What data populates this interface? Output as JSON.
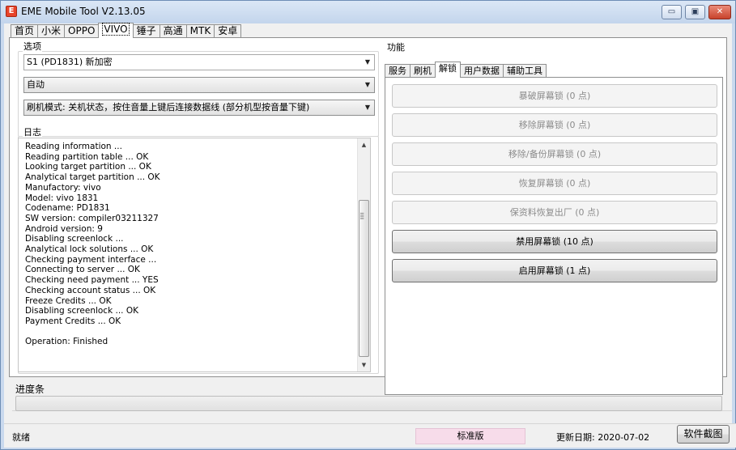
{
  "window": {
    "title": "EME Mobile Tool V2.13.05",
    "icon_letter": "E",
    "minimize": "▭",
    "maximize": "▣",
    "close": "✕"
  },
  "tabs": [
    "首页",
    "小米",
    "OPPO",
    "VIVO",
    "锤子",
    "高通",
    "MTK",
    "安卓"
  ],
  "active_tab": 3,
  "options": {
    "label": "选项",
    "device_model": "S1 (PD1831) 新加密",
    "mode": "自动",
    "flash_hint": "刷机模式: 关机状态，按住音量上键后连接数据线 (部分机型按音量下键)"
  },
  "log": {
    "label": "日志",
    "lines": [
      "Reading information ...",
      "Reading partition table ... OK",
      "Looking target partition ... OK",
      "Analytical target partition ... OK",
      "Manufactory: vivo",
      "Model: vivo 1831",
      "Codename: PD1831",
      "SW version: compiler03211327",
      "Android version: 9",
      "Disabling screenlock ...",
      "Analytical lock solutions ... OK",
      "Checking payment interface ...",
      "Connecting to server ... OK",
      "Checking need payment ... YES",
      "Checking account status ... OK",
      "Freeze Credits ... OK",
      "Disabling screenlock ... OK",
      "Payment Credits ... OK",
      "",
      "Operation: Finished"
    ]
  },
  "functions": {
    "label": "功能",
    "subtabs": [
      "服务",
      "刷机",
      "解锁",
      "用户数据",
      "辅助工具"
    ],
    "active_subtab": 2,
    "buttons": [
      {
        "label": "暴破屏幕锁 (0 点)",
        "enabled": false
      },
      {
        "label": "移除屏幕锁 (0 点)",
        "enabled": false
      },
      {
        "label": "移除/备份屏幕锁 (0 点)",
        "enabled": false
      },
      {
        "label": "恢复屏幕锁 (0 点)",
        "enabled": false
      },
      {
        "label": "保资料恢复出厂 (0 点)",
        "enabled": false
      },
      {
        "label": "禁用屏幕锁 (10 点)",
        "enabled": true
      },
      {
        "label": "启用屏幕锁 (1 点)",
        "enabled": true
      }
    ]
  },
  "progress": {
    "label": "进度条",
    "value": 0
  },
  "status": {
    "ready": "就绪",
    "edition": "标准版",
    "update_date": "更新日期: 2020-07-02",
    "capture_button": "软件截图"
  }
}
